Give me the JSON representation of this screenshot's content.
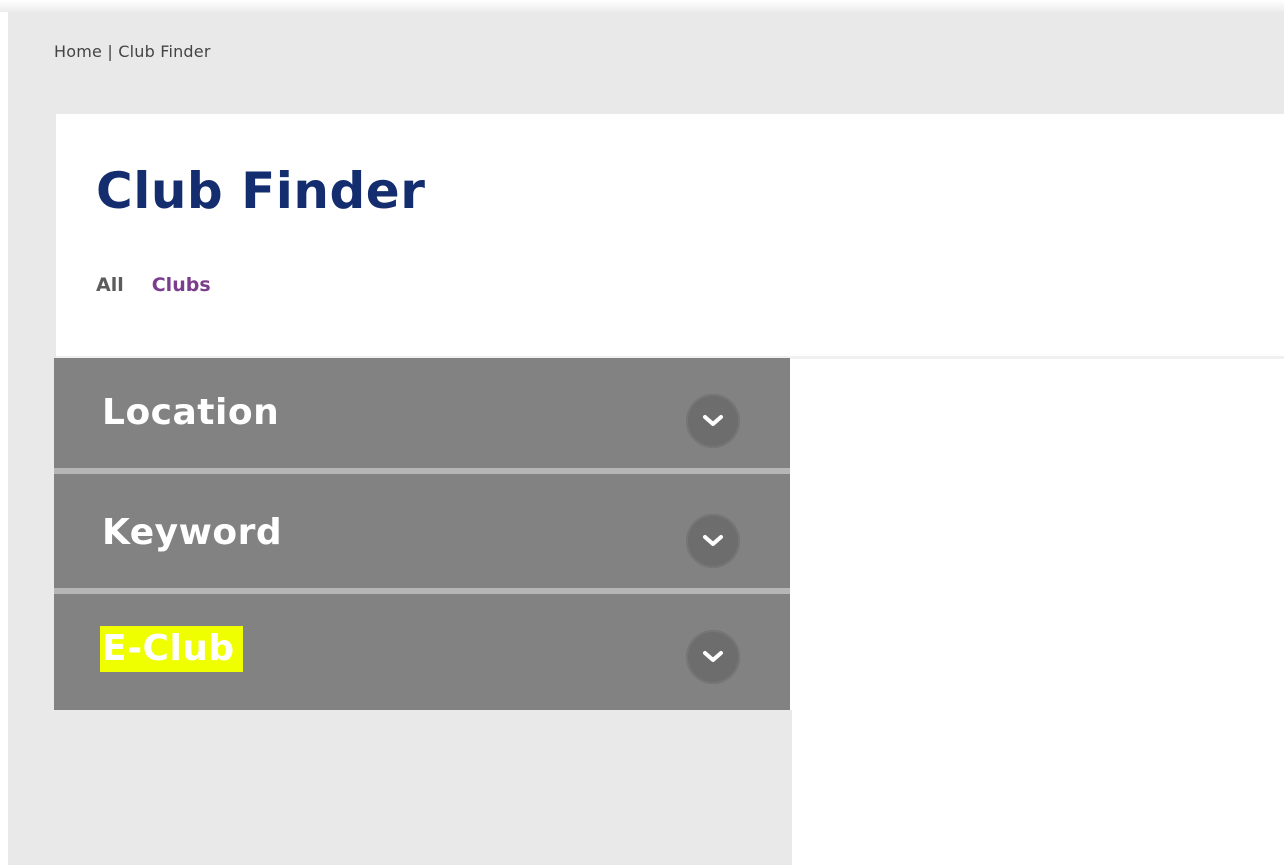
{
  "breadcrumb": "Home | Club Finder",
  "page_title": "Club Finder",
  "tabs": [
    {
      "label": "All",
      "color": "#5c5c5c"
    },
    {
      "label": "Clubs",
      "color": "#7b3d8e"
    }
  ],
  "filters": [
    {
      "label": "Location",
      "icon": "chevron-down-icon",
      "highlighted": false
    },
    {
      "label": "Keyword",
      "icon": "chevron-down-icon",
      "highlighted": false
    },
    {
      "label": "E-Club",
      "icon": "chevron-down-icon",
      "highlighted": true
    }
  ],
  "colors": {
    "title": "#142d6e",
    "accordion_bg": "#828282",
    "highlight": "#f0ff00"
  }
}
